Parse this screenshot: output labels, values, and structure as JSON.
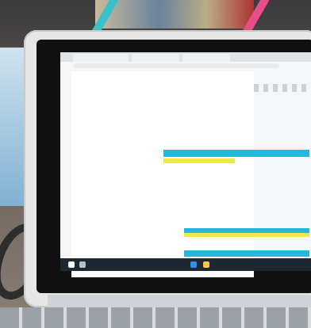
{
  "scene": {
    "description_colors": {
      "page_bg": "#f4f6f8",
      "table_header": "#27b6dc",
      "table_subheader": "#eee64a",
      "share_button": "#4b7ede"
    }
  },
  "document": {
    "title": "",
    "share_label": "",
    "sidebar": []
  },
  "icons": [
    "window-icon",
    "search-icon",
    "browser-icon",
    "folder-icon"
  ]
}
